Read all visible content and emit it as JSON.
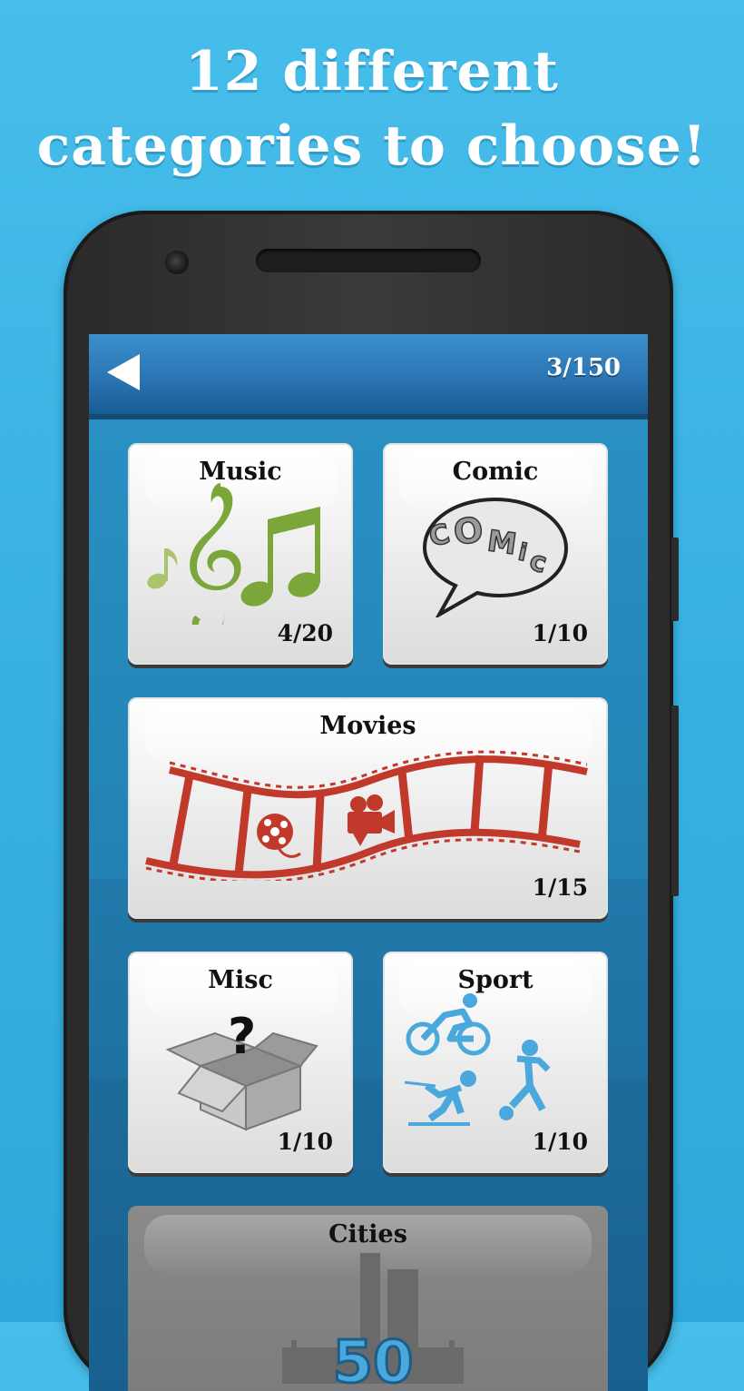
{
  "promo": {
    "line1": "12 different",
    "line2": "categories to choose!"
  },
  "header": {
    "counter": "3/150",
    "back_icon": "back-arrow-icon"
  },
  "categories": [
    {
      "title": "Music",
      "progress": "4/20",
      "icon": "music-notes-icon"
    },
    {
      "title": "Comic",
      "progress": "1/10",
      "icon": "comic-bubble-icon"
    },
    {
      "title": "Movies",
      "progress": "1/15",
      "icon": "film-strip-icon"
    },
    {
      "title": "Misc",
      "progress": "1/10",
      "icon": "mystery-box-icon"
    },
    {
      "title": "Sport",
      "progress": "1/10",
      "icon": "sport-figures-icon"
    },
    {
      "title": "Cities",
      "locked_value": "50",
      "icon": "city-skyline-icon"
    }
  ],
  "colors": {
    "background": "#3fb6e6",
    "accent_green": "#7aa63a",
    "film_red": "#c0392b",
    "sport_blue": "#4aa8dc"
  }
}
